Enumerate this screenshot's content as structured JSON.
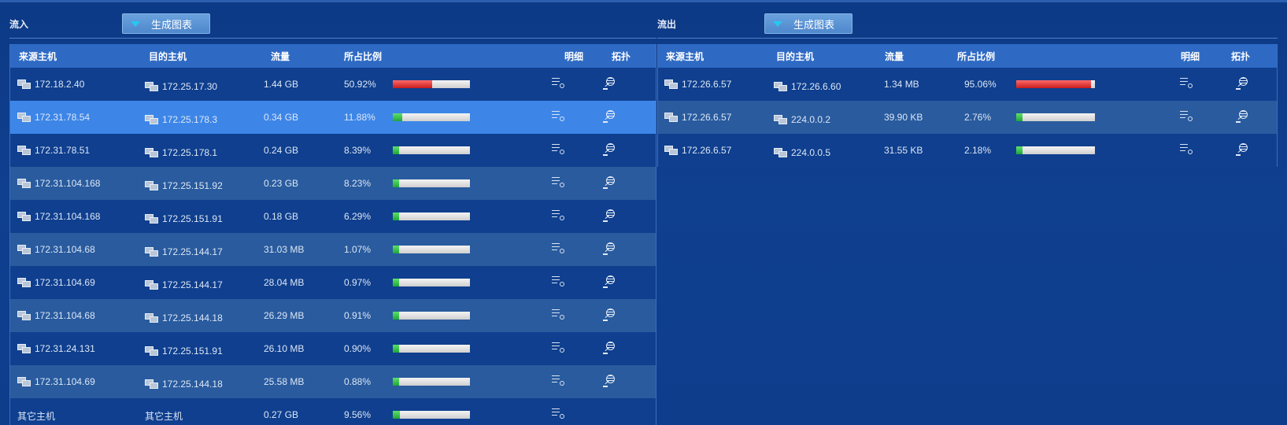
{
  "inbound": {
    "label": "流入",
    "button": "生成图表",
    "columns": [
      "来源主机",
      "目的主机",
      "流量",
      "所占比例",
      "明细",
      "拓扑"
    ],
    "rows": [
      {
        "src": "172.18.2.40",
        "dst": "172.25.17.30",
        "flow": "1.44 GB",
        "pct": "50.92%",
        "ratio": 0.5092,
        "color": "red"
      },
      {
        "src": "172.31.78.54",
        "dst": "172.25.178.3",
        "flow": "0.34 GB",
        "pct": "11.88%",
        "ratio": 0.1188,
        "color": "green"
      },
      {
        "src": "172.31.78.51",
        "dst": "172.25.178.1",
        "flow": "0.24 GB",
        "pct": "8.39%",
        "ratio": 0.0839,
        "color": "green"
      },
      {
        "src": "172.31.104.168",
        "dst": "172.25.151.92",
        "flow": "0.23 GB",
        "pct": "8.23%",
        "ratio": 0.0823,
        "color": "green"
      },
      {
        "src": "172.31.104.168",
        "dst": "172.25.151.91",
        "flow": "0.18 GB",
        "pct": "6.29%",
        "ratio": 0.0629,
        "color": "green"
      },
      {
        "src": "172.31.104.68",
        "dst": "172.25.144.17",
        "flow": "31.03 MB",
        "pct": "1.07%",
        "ratio": 0.0107,
        "color": "green"
      },
      {
        "src": "172.31.104.69",
        "dst": "172.25.144.17",
        "flow": "28.04 MB",
        "pct": "0.97%",
        "ratio": 0.0097,
        "color": "green"
      },
      {
        "src": "172.31.104.68",
        "dst": "172.25.144.18",
        "flow": "26.29 MB",
        "pct": "0.91%",
        "ratio": 0.0091,
        "color": "green"
      },
      {
        "src": "172.31.24.131",
        "dst": "172.25.151.91",
        "flow": "26.10 MB",
        "pct": "0.90%",
        "ratio": 0.009,
        "color": "green"
      },
      {
        "src": "172.31.104.69",
        "dst": "172.25.144.18",
        "flow": "25.58 MB",
        "pct": "0.88%",
        "ratio": 0.0088,
        "color": "green"
      }
    ],
    "other": {
      "src": "其它主机",
      "dst": "其它主机",
      "flow": "0.27 GB",
      "pct": "9.56%",
      "ratio": 0.0956,
      "color": "green"
    }
  },
  "outbound": {
    "label": "流出",
    "button": "生成图表",
    "columns": [
      "来源主机",
      "目的主机",
      "流量",
      "所占比例",
      "明细",
      "拓扑"
    ],
    "rows": [
      {
        "src": "172.26.6.57",
        "dst": "172.26.6.60",
        "flow": "1.34 MB",
        "pct": "95.06%",
        "ratio": 0.9506,
        "color": "red"
      },
      {
        "src": "172.26.6.57",
        "dst": "224.0.0.2",
        "flow": "39.90 KB",
        "pct": "2.76%",
        "ratio": 0.0276,
        "color": "green"
      },
      {
        "src": "172.26.6.57",
        "dst": "224.0.0.5",
        "flow": "31.55 KB",
        "pct": "2.18%",
        "ratio": 0.0218,
        "color": "green"
      }
    ]
  },
  "selected_inbound_row": 1,
  "colors": {
    "accent": "#3d86e8",
    "header": "#2e6ac4",
    "bar_red": "#d62828",
    "bar_green": "#2bb84a"
  }
}
